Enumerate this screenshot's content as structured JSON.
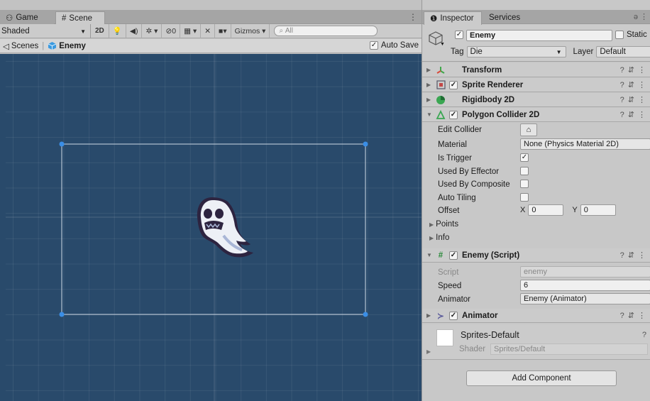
{
  "scene_view": {
    "tabs": [
      {
        "label": "Game",
        "icon": "gamepad-icon"
      },
      {
        "label": "Scene",
        "icon": "hash-icon"
      }
    ],
    "toolbar": {
      "shading_mode": "Shaded",
      "mode_2d": "2D",
      "fx_count": "0",
      "gizmos_label": "Gizmos",
      "search_placeholder": "All"
    },
    "breadcrumb": {
      "scenes_label": "Scenes",
      "object_label": "Enemy"
    },
    "auto_save_label": "Auto Save",
    "auto_save_checked": true,
    "viewport": {
      "background_color": "#294a6b",
      "collider_color": "#cfd9e6",
      "handle_color": "#3a8ee6"
    }
  },
  "inspector": {
    "tabs": [
      {
        "label": "Inspector",
        "icon": "info-icon"
      },
      {
        "label": "Services",
        "icon": ""
      }
    ],
    "object": {
      "name": "Enemy",
      "active": true,
      "static_label": "Static",
      "tag_label": "Tag",
      "tag_value": "Die",
      "layer_label": "Layer",
      "layer_value": "Default"
    },
    "components": [
      {
        "name": "Transform",
        "icon": "transform-icon",
        "has_checkbox": false
      },
      {
        "name": "Sprite Renderer",
        "icon": "sprite-renderer-icon",
        "has_checkbox": true
      },
      {
        "name": "Rigidbody 2D",
        "icon": "rigidbody-icon",
        "has_checkbox": false
      },
      {
        "name": "Polygon Collider 2D",
        "icon": "polygon-collider-icon",
        "has_checkbox": true
      },
      {
        "name": "Enemy (Script)",
        "icon": "script-icon",
        "has_checkbox": true
      },
      {
        "name": "Animator",
        "icon": "animator-icon",
        "has_checkbox": true
      }
    ],
    "polygon_collider": {
      "edit_collider_label": "Edit Collider",
      "material_label": "Material",
      "material_value": "None (Physics Material 2D)",
      "is_trigger_label": "Is Trigger",
      "is_trigger_checked": true,
      "used_by_effector_label": "Used By Effector",
      "used_by_composite_label": "Used By Composite",
      "auto_tiling_label": "Auto Tiling",
      "offset_label": "Offset",
      "offset_x_label": "X",
      "offset_x": "0",
      "offset_y_label": "Y",
      "offset_y": "0",
      "points_label": "Points",
      "info_label": "Info"
    },
    "enemy_script": {
      "script_label": "Script",
      "script_value": "enemy",
      "speed_label": "Speed",
      "speed_value": "6",
      "animator_label": "Animator",
      "animator_value": "Enemy (Animator)"
    },
    "material": {
      "name": "Sprites-Default",
      "shader_label": "Shader",
      "shader_value": "Sprites/Default"
    },
    "add_component_label": "Add Component"
  }
}
